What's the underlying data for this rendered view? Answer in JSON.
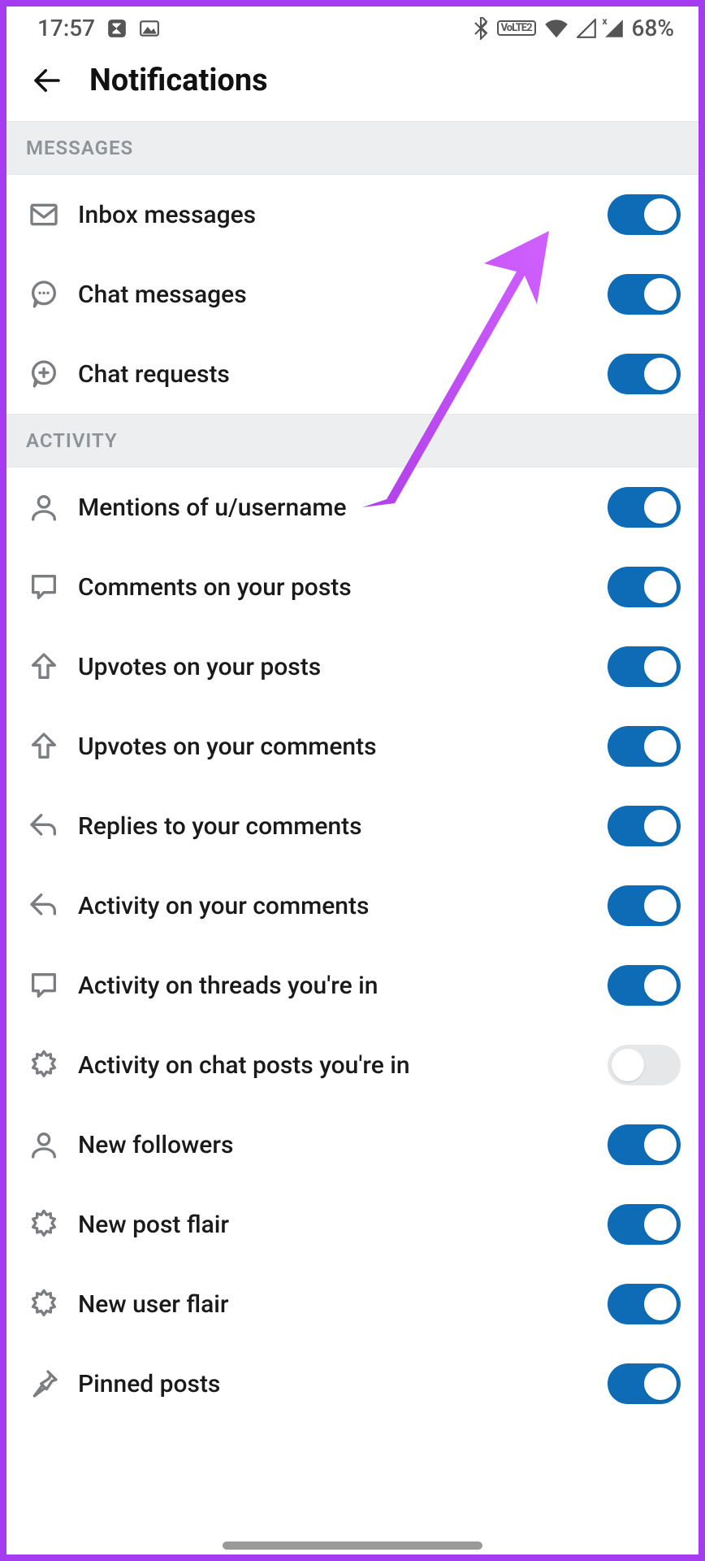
{
  "status": {
    "time": "17:57",
    "battery": "68%",
    "volte_badge": "VoLTE2"
  },
  "header": {
    "title": "Notifications"
  },
  "sections": [
    {
      "title": "MESSAGES",
      "items": [
        {
          "icon": "envelope-icon",
          "label": "Inbox messages",
          "on": true,
          "key": "inbox-messages"
        },
        {
          "icon": "chat-dots-icon",
          "label": "Chat messages",
          "on": true,
          "key": "chat-messages"
        },
        {
          "icon": "chat-plus-icon",
          "label": "Chat requests",
          "on": true,
          "key": "chat-requests"
        }
      ]
    },
    {
      "title": "ACTIVITY",
      "items": [
        {
          "icon": "user-icon",
          "label": "Mentions of u/username",
          "on": true,
          "key": "mentions"
        },
        {
          "icon": "comment-icon",
          "label": "Comments on your posts",
          "on": true,
          "key": "comments-posts"
        },
        {
          "icon": "upvote-icon",
          "label": "Upvotes on your posts",
          "on": true,
          "key": "upvotes-posts"
        },
        {
          "icon": "upvote-icon",
          "label": "Upvotes on your comments",
          "on": true,
          "key": "upvotes-comments"
        },
        {
          "icon": "reply-icon",
          "label": "Replies to your comments",
          "on": true,
          "key": "replies-comments"
        },
        {
          "icon": "reply-icon",
          "label": "Activity on your comments",
          "on": true,
          "key": "activity-comments"
        },
        {
          "icon": "comment-icon",
          "label": "Activity on threads you're in",
          "on": true,
          "key": "activity-threads"
        },
        {
          "icon": "burst-icon",
          "label": "Activity on chat posts you're in",
          "on": false,
          "key": "activity-chat-posts"
        },
        {
          "icon": "user-icon",
          "label": "New followers",
          "on": true,
          "key": "new-followers"
        },
        {
          "icon": "burst-icon",
          "label": "New post flair",
          "on": true,
          "key": "new-post-flair"
        },
        {
          "icon": "burst-icon",
          "label": "New user flair",
          "on": true,
          "key": "new-user-flair"
        },
        {
          "icon": "pin-icon",
          "label": "Pinned posts",
          "on": true,
          "key": "pinned-posts"
        }
      ]
    }
  ]
}
